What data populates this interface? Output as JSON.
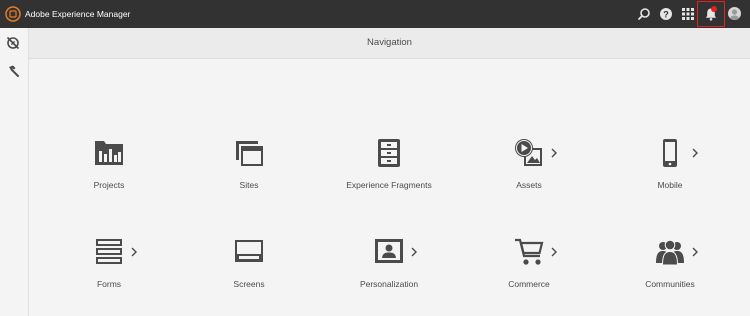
{
  "app": {
    "title": "Adobe Experience Manager"
  },
  "header": {
    "title": "Navigation"
  },
  "topbar": {
    "icons": [
      "search-icon",
      "help-icon",
      "apps-grid-icon",
      "bell-icon",
      "user-avatar"
    ]
  },
  "colors": {
    "topbar": "#323232",
    "icon": "#4b4b4b",
    "badge": "#e4211e"
  },
  "tiles": [
    {
      "label": "Projects",
      "icon": "projects-icon",
      "chevron": false
    },
    {
      "label": "Sites",
      "icon": "sites-icon",
      "chevron": false
    },
    {
      "label": "Experience Fragments",
      "icon": "experience-fragments-icon",
      "chevron": false
    },
    {
      "label": "Assets",
      "icon": "assets-icon",
      "chevron": true
    },
    {
      "label": "Mobile",
      "icon": "mobile-icon",
      "chevron": true
    },
    {
      "label": "Forms",
      "icon": "forms-icon",
      "chevron": true
    },
    {
      "label": "Screens",
      "icon": "screens-icon",
      "chevron": false
    },
    {
      "label": "Personalization",
      "icon": "personalization-icon",
      "chevron": true
    },
    {
      "label": "Commerce",
      "icon": "commerce-icon",
      "chevron": true
    },
    {
      "label": "Communities",
      "icon": "communities-icon",
      "chevron": true
    }
  ]
}
